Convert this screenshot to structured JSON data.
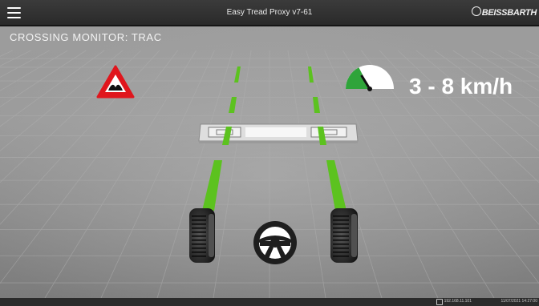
{
  "header": {
    "app_title": "Easy Tread Proxy v7-61",
    "brand": "BEISSBARTH",
    "menu_icon": "hamburger-menu-icon"
  },
  "monitor": {
    "title": "CROSSING MONITOR: TRAC",
    "speed_range": "3 - 8 km/h",
    "speed_gauge_level": 0.35,
    "warning_icon": "bump-warning-sign-icon",
    "steering_icon": "steering-wheel-icon",
    "colors": {
      "track": "#5cc21f",
      "warning_border": "#e0161d",
      "gauge_green": "#2fa43a"
    }
  },
  "status": {
    "ip": "192.168.11.101",
    "datetime": "11/07/2021 14:27:00"
  }
}
